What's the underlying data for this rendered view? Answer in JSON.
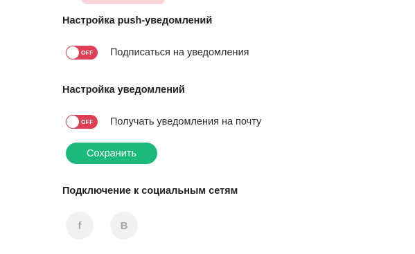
{
  "push_section": {
    "title": "Настройка push-уведомлений",
    "toggle": {
      "state_label": "OFF",
      "label": "Подписаться на уведомления",
      "on": false
    }
  },
  "notifications_section": {
    "title": "Настройка уведомлений",
    "toggle": {
      "state_label": "OFF",
      "label": "Получать уведомления на почту",
      "on": false
    },
    "save_label": "Сохранить"
  },
  "social_section": {
    "title": "Подключение к социальным сетям",
    "items": [
      {
        "icon": "facebook-icon",
        "glyph": "f"
      },
      {
        "icon": "vk-icon",
        "glyph": "B"
      }
    ]
  },
  "colors": {
    "toggle_off": "#df3f55",
    "save_button": "#1bb97a",
    "social_bg": "#f1f1f1",
    "social_glyph": "#a7a7a7"
  }
}
